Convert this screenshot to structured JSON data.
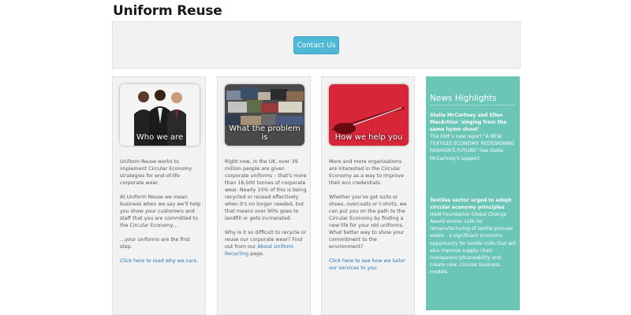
{
  "header": {
    "title": "Uniform Reuse"
  },
  "cta": {
    "contact_label": "Contact Us"
  },
  "cards": [
    {
      "caption": "Who we are",
      "paragraphs": [
        "Uniform Reuse works to implement Circular Economy strategies for end-of-life corporate wear.",
        "At Uniform Reuse we mean business when we say we'll help you show your customers and staff that you are committed to the Circular Economy…",
        "…your uniforms are the first step."
      ],
      "link": "Click here to read why we care."
    },
    {
      "caption": "What the problem is",
      "paragraphs": [
        "Right now, in the UK, over 39 million people are given corporate uniforms – that's more than 16,000 tonnes of corporate wear. Nearly 10% of this is being recycled or reused effectively when it's no longer needed, but that means over 90% goes to landfill or gets incinerated."
      ],
      "p2_before": "Why is it so difficult to recycle or reuse our corporate wear? Find out from our ",
      "p2_link": "About Uniform Recycling",
      "p2_after": " page."
    },
    {
      "caption": "How we help you",
      "paragraphs": [
        "More and more organisations are interested in the Circular Economy as a way to improve their eco credentials.",
        "Whether you've got suits or shoes, overcoats or t-shirts, we can put you on the path to the Circular Economy by finding a new life for your old uniforms. What better way to show your commitment to the environment?"
      ],
      "link": "Click here to see how we tailor our services to you."
    }
  ],
  "news": {
    "title": "News Highlights",
    "items": [
      {
        "headline": "Stella McCartney and Ellen MacArthur 'singing from the same hymn sheet'",
        "body": "The EMF's new report \"A NEW TEXTILES ECONOMY: REDESIGNING FASHION'S FUTURE\" has Stella McCartney's support"
      },
      {
        "headline": "Textiles sector urged to adopt circular economy principles",
        "body": "H&M Foundation Global Change Award winner calls for remanufacturing of textile process waste - a significant economic opportunity for textile mills that will also improve supply chain transparency/traceability and create new, circular business models."
      }
    ]
  },
  "colors": {
    "button": "#4fb8d8",
    "news_bg": "#6bc6b8",
    "link": "#2a74b0",
    "panel_bg": "#f2f2f2"
  }
}
